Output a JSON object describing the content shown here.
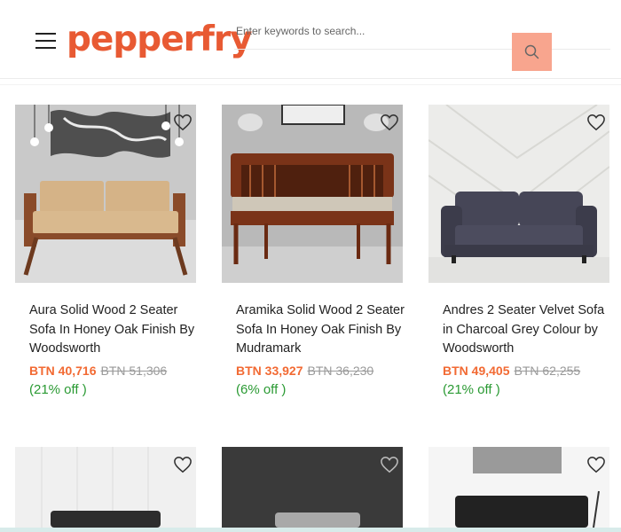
{
  "header": {
    "logo": "pepperfry",
    "search_placeholder": "Enter keywords to search..."
  },
  "products": [
    {
      "title": "Aura Solid Wood 2 Seater Sofa In Honey Oak Finish By Woodsworth",
      "price": "BTN 40,716",
      "mrp": "BTN 51,306",
      "discount": "(21% off )"
    },
    {
      "title": "Aramika Solid Wood 2 Seater Sofa In Honey Oak Finish By Mudramark",
      "price": "BTN 33,927",
      "mrp": "BTN 36,230",
      "discount": "(6% off )"
    },
    {
      "title": "Andres 2 Seater Velvet Sofa in Charcoal Grey Colour by Woodsworth",
      "price": "BTN 49,405",
      "mrp": "BTN 62,255",
      "discount": "(21% off )"
    }
  ],
  "colors": {
    "brand": "#e85a33",
    "price": "#f26a33",
    "discount": "#2a9a33",
    "search_button": "#f8a58e"
  }
}
